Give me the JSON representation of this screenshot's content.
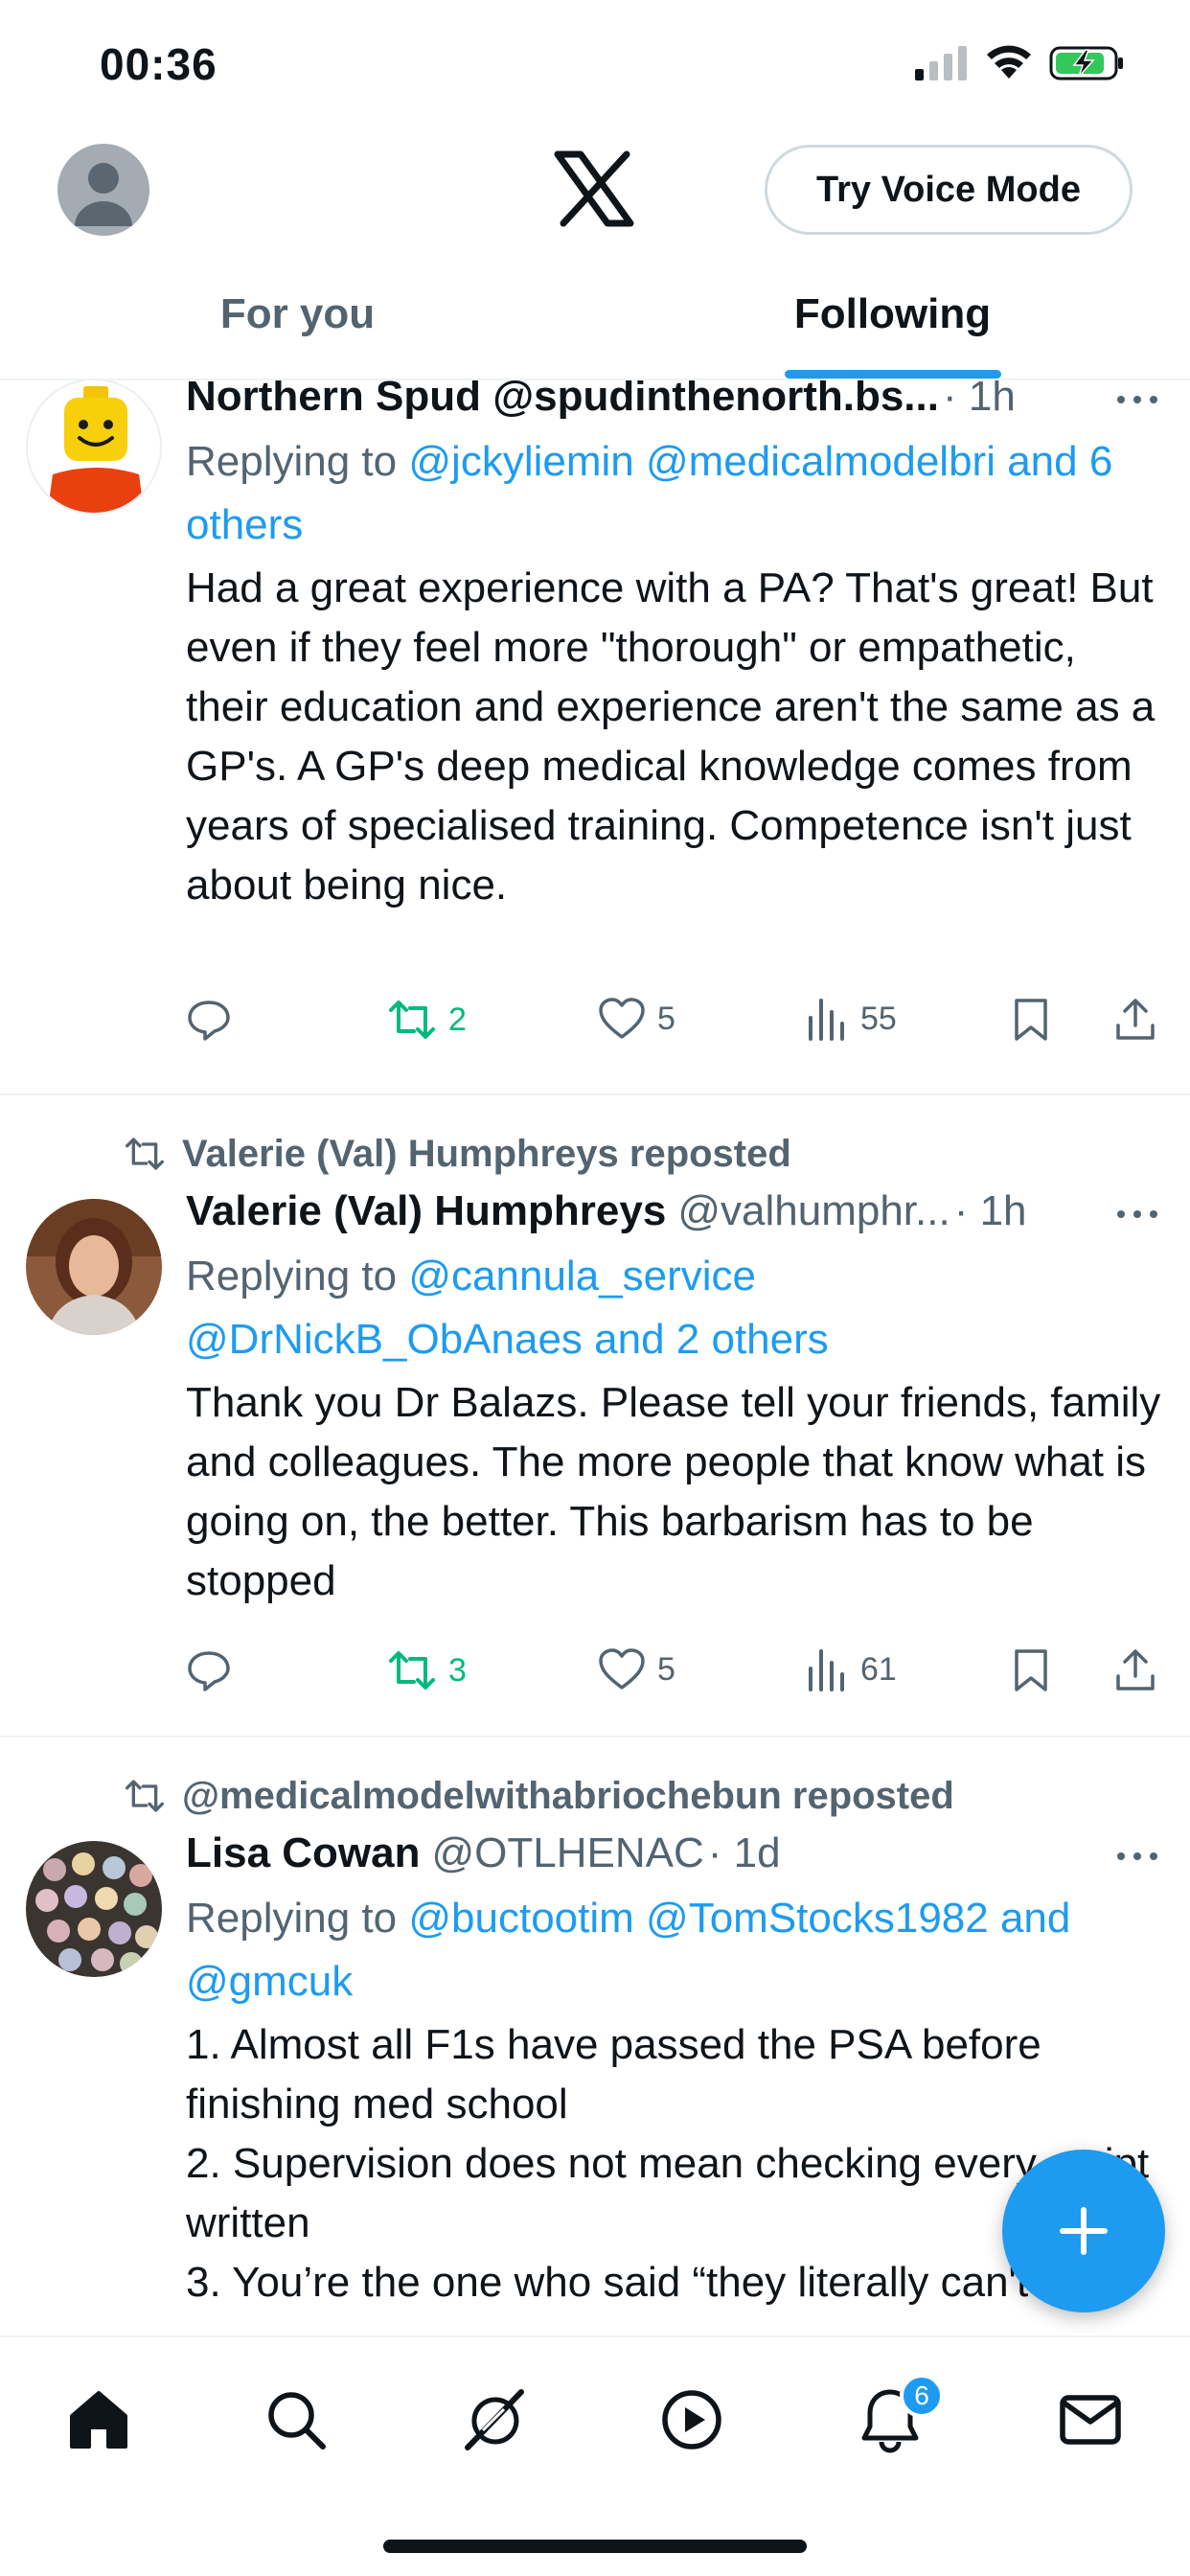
{
  "status_bar": {
    "time": "00:36"
  },
  "header": {
    "voice_mode_label": "Try Voice Mode",
    "tabs": [
      {
        "label": "For you",
        "active": false
      },
      {
        "label": "Following",
        "active": true
      }
    ]
  },
  "posts": [
    {
      "name": "Northern Spud @spudinthenorth.bs...",
      "handle": "",
      "time": "· 1h",
      "reply_prefix": "Replying to",
      "reply_mentions": "@jckyliemin @medicalmodelbri and 6 others",
      "text": "Had a great experience with a PA? That's great! But even if they feel more \"thorough\" or empathetic, their education and experience aren't the same as a GP's. A GP's deep medical knowledge comes from years of specialised training. Competence isn't just about being nice.",
      "reply_count": "",
      "repost_count": "2",
      "like_count": "5",
      "view_count": "55"
    },
    {
      "reposted_by": "Valerie (Val) Humphreys reposted",
      "name": "Valerie (Val) Humphreys",
      "handle": "@valhumphr...",
      "time": "· 1h",
      "reply_prefix": "Replying to",
      "reply_mentions": "@cannula_service @DrNickB_ObAnaes and 2 others",
      "text": "Thank you Dr Balazs. Please tell your friends, family and colleagues. The more people that know what is going on, the better. This barbarism has to be stopped",
      "reply_count": "",
      "repost_count": "3",
      "like_count": "5",
      "view_count": "61"
    },
    {
      "reposted_by": "@medicalmodelwithabriochebun reposted",
      "name": "Lisa Cowan",
      "handle": "@OTLHENAC",
      "time": "· 1d",
      "reply_prefix": "Replying to",
      "reply_mentions": "@buctootim @TomStocks1982 and @gmcuk",
      "text_lines": [
        "1. Almost all F1s have passed the PSA before finishing med school",
        "2. Supervision does not mean checking every script written",
        "3. You’re the one who said “they literally can't"
      ]
    }
  ],
  "bottom_nav": {
    "notifications_badge": "6"
  },
  "colors": {
    "accent": "#1d9bf0",
    "repost_green": "#00ba7c",
    "secondary_text": "#536471",
    "primary_text": "#0f1419"
  },
  "icons": [
    "signal-icon",
    "wifi-icon",
    "battery-charging-icon",
    "x-logo-icon",
    "reply-icon",
    "repost-icon",
    "like-icon",
    "views-icon",
    "bookmark-icon",
    "share-icon",
    "compose-plus-icon",
    "home-icon",
    "search-icon",
    "grok-icon",
    "video-icon",
    "notifications-icon",
    "messages-icon"
  ]
}
